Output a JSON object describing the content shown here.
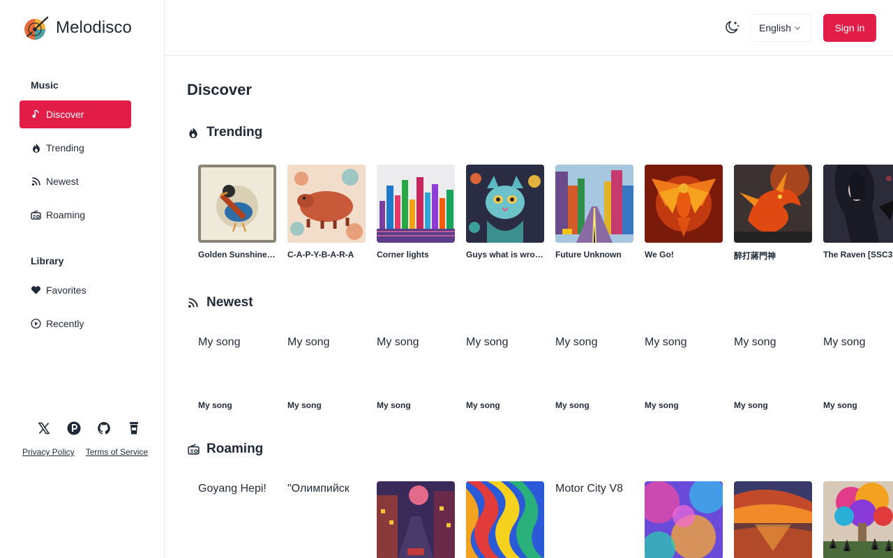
{
  "brand": {
    "name": "Melodisco"
  },
  "sidebar": {
    "music_title": "Music",
    "music_items": [
      {
        "label": "Discover",
        "icon": "music-note-icon",
        "active": true
      },
      {
        "label": "Trending",
        "icon": "flame-icon"
      },
      {
        "label": "Newest",
        "icon": "rss-icon"
      },
      {
        "label": "Roaming",
        "icon": "radio-icon"
      }
    ],
    "library_title": "Library",
    "library_items": [
      {
        "label": "Favorites",
        "icon": "heart-icon"
      },
      {
        "label": "Recently",
        "icon": "play-circle-icon"
      }
    ],
    "social": [
      "x-icon",
      "producthunt-icon",
      "github-icon",
      "coffee-cup-icon"
    ],
    "legal": {
      "privacy": "Privacy Policy",
      "terms": "Terms of Service"
    }
  },
  "header": {
    "theme_icon": "moon-icon",
    "language": "English",
    "signin": "Sign in"
  },
  "main": {
    "title": "Discover",
    "trending": {
      "title": "Trending",
      "items": [
        {
          "title": "Golden Sunshine…"
        },
        {
          "title": "C-A-P-Y-B-A-R-A"
        },
        {
          "title": "Corner lights"
        },
        {
          "title": "Guys what is wro…"
        },
        {
          "title": "Future Unknown"
        },
        {
          "title": "We Go!"
        },
        {
          "title": "醉打蔣門神"
        },
        {
          "title": "The Raven [SSC3"
        }
      ]
    },
    "newest": {
      "title": "Newest",
      "items": [
        {
          "title": "My song",
          "alt": "My song"
        },
        {
          "title": "My song",
          "alt": "My song"
        },
        {
          "title": "My song",
          "alt": "My song"
        },
        {
          "title": "My song",
          "alt": "My song"
        },
        {
          "title": "My song",
          "alt": "My song"
        },
        {
          "title": "My song",
          "alt": "My song"
        },
        {
          "title": "My song",
          "alt": "My song"
        },
        {
          "title": "My song",
          "alt": "My song"
        }
      ]
    },
    "roaming": {
      "title": "Roaming",
      "items": [
        {
          "alt": "Goyang Hepi!"
        },
        {
          "alt": "\"Олимпийск"
        },
        {
          "alt": ""
        },
        {
          "alt": ""
        },
        {
          "alt": "Motor City V8"
        },
        {
          "alt": ""
        },
        {
          "alt": ""
        },
        {
          "alt": ""
        }
      ]
    }
  },
  "colors": {
    "accent": "#e11d48",
    "text": "#1f2937",
    "border": "#e5e7eb"
  }
}
